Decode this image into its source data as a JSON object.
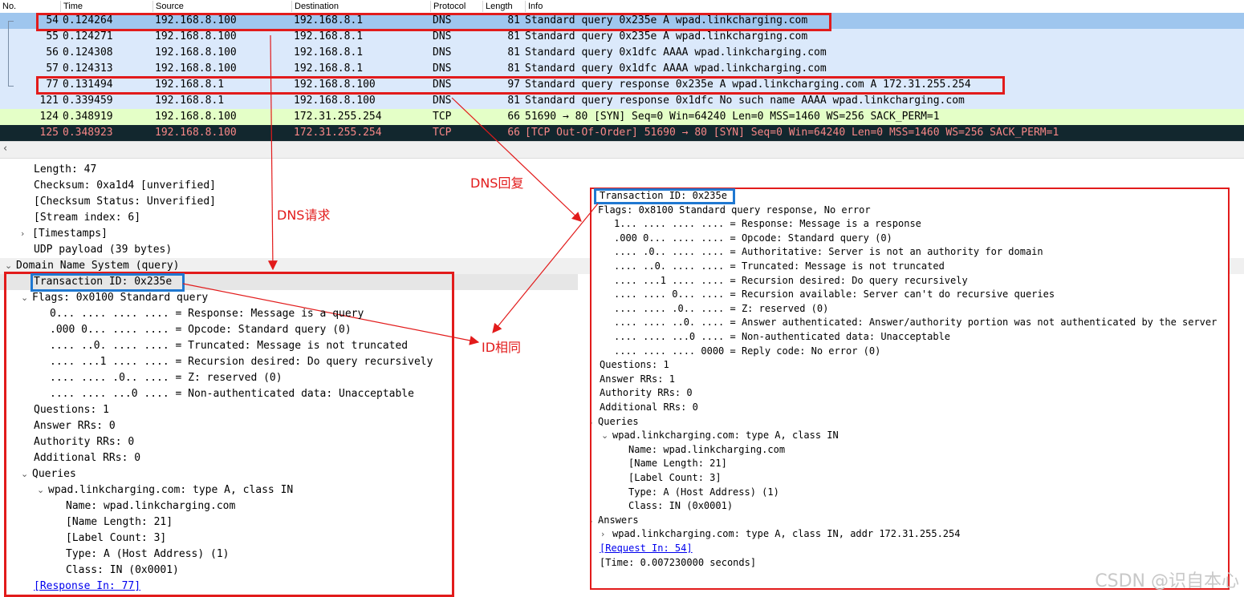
{
  "columns": {
    "no": "No.",
    "time": "Time",
    "source": "Source",
    "destination": "Destination",
    "protocol": "Protocol",
    "length": "Length",
    "info": "Info"
  },
  "packets": [
    {
      "no": "54",
      "time": "0.124264",
      "source": "192.168.8.100",
      "destination": "192.168.8.1",
      "protocol": "DNS",
      "length": "81",
      "info": "Standard query 0x235e A wpad.linkcharging.com",
      "bg": "#9fc6ee",
      "fg": "#000000"
    },
    {
      "no": "55",
      "time": "0.124271",
      "source": "192.168.8.100",
      "destination": "192.168.8.1",
      "protocol": "DNS",
      "length": "81",
      "info": "Standard query 0x235e A wpad.linkcharging.com",
      "bg": "#dbe9fb",
      "fg": "#000000"
    },
    {
      "no": "56",
      "time": "0.124308",
      "source": "192.168.8.100",
      "destination": "192.168.8.1",
      "protocol": "DNS",
      "length": "81",
      "info": "Standard query 0x1dfc AAAA wpad.linkcharging.com",
      "bg": "#dbe9fb",
      "fg": "#000000"
    },
    {
      "no": "57",
      "time": "0.124313",
      "source": "192.168.8.100",
      "destination": "192.168.8.1",
      "protocol": "DNS",
      "length": "81",
      "info": "Standard query 0x1dfc AAAA wpad.linkcharging.com",
      "bg": "#dbe9fb",
      "fg": "#000000"
    },
    {
      "no": "77",
      "time": "0.131494",
      "source": "192.168.8.1",
      "destination": "192.168.8.100",
      "protocol": "DNS",
      "length": "97",
      "info": "Standard query response 0x235e A wpad.linkcharging.com A 172.31.255.254",
      "bg": "#dbe9fb",
      "fg": "#000000"
    },
    {
      "no": "121",
      "time": "0.339459",
      "source": "192.168.8.1",
      "destination": "192.168.8.100",
      "protocol": "DNS",
      "length": "81",
      "info": "Standard query response 0x1dfc No such name AAAA wpad.linkcharging.com",
      "bg": "#dbe9fb",
      "fg": "#000000"
    },
    {
      "no": "124",
      "time": "0.348919",
      "source": "192.168.8.100",
      "destination": "172.31.255.254",
      "protocol": "TCP",
      "length": "66",
      "info": "51690 → 80 [SYN] Seq=0 Win=64240 Len=0 MSS=1460 WS=256 SACK_PERM=1",
      "bg": "#e4ffc7",
      "fg": "#000000"
    },
    {
      "no": "125",
      "time": "0.348923",
      "source": "192.168.8.100",
      "destination": "172.31.255.254",
      "protocol": "TCP",
      "length": "66",
      "info": "[TCP Out-Of-Order] 51690 → 80 [SYN] Seq=0 Win=64240 Len=0 MSS=1460 WS=256 SACK_PERM=1",
      "bg": "#12272e",
      "fg": "#f78787"
    }
  ],
  "request_detail": [
    {
      "text": "Length: 47",
      "indent": 2,
      "tog": ""
    },
    {
      "text": "Checksum: 0xa1d4 [unverified]",
      "indent": 2,
      "tog": ""
    },
    {
      "text": "[Checksum Status: Unverified]",
      "indent": 2,
      "tog": ""
    },
    {
      "text": "[Stream index: 6]",
      "indent": 2,
      "tog": ""
    },
    {
      "text": "[Timestamps]",
      "indent": 2,
      "tog": "›"
    },
    {
      "text": "UDP payload (39 bytes)",
      "indent": 2,
      "tog": ""
    },
    {
      "text": "Domain Name System (query)",
      "indent": 0,
      "tog": "⌄"
    },
    {
      "text": "Transaction ID: 0x235e",
      "indent": 2,
      "tog": ""
    },
    {
      "text": "Flags: 0x0100 Standard query",
      "indent": 2,
      "tog": "⌄"
    },
    {
      "text": "0... .... .... .... = Response: Message is a query",
      "indent": 4,
      "tog": ""
    },
    {
      "text": ".000 0... .... .... = Opcode: Standard query (0)",
      "indent": 4,
      "tog": ""
    },
    {
      "text": ".... ..0. .... .... = Truncated: Message is not truncated",
      "indent": 4,
      "tog": ""
    },
    {
      "text": ".... ...1 .... .... = Recursion desired: Do query recursively",
      "indent": 4,
      "tog": ""
    },
    {
      "text": ".... .... .0.. .... = Z: reserved (0)",
      "indent": 4,
      "tog": ""
    },
    {
      "text": ".... .... ...0 .... = Non-authenticated data: Unacceptable",
      "indent": 4,
      "tog": ""
    },
    {
      "text": "Questions: 1",
      "indent": 2,
      "tog": ""
    },
    {
      "text": "Answer RRs: 0",
      "indent": 2,
      "tog": ""
    },
    {
      "text": "Authority RRs: 0",
      "indent": 2,
      "tog": ""
    },
    {
      "text": "Additional RRs: 0",
      "indent": 2,
      "tog": ""
    },
    {
      "text": "Queries",
      "indent": 2,
      "tog": "⌄"
    },
    {
      "text": "wpad.linkcharging.com: type A, class IN",
      "indent": 4,
      "tog": "⌄"
    },
    {
      "text": "Name: wpad.linkcharging.com",
      "indent": 6,
      "tog": ""
    },
    {
      "text": "[Name Length: 21]",
      "indent": 6,
      "tog": ""
    },
    {
      "text": "[Label Count: 3]",
      "indent": 6,
      "tog": ""
    },
    {
      "text": "Type: A (Host Address) (1)",
      "indent": 6,
      "tog": ""
    },
    {
      "text": "Class: IN (0x0001)",
      "indent": 6,
      "tog": ""
    },
    {
      "text": "[Response In: 77]",
      "indent": 2,
      "tog": "",
      "link": true
    }
  ],
  "response_detail": [
    {
      "text": "Transaction ID: 0x235e",
      "indent": 0,
      "tog": ""
    },
    {
      "text": "Flags: 0x8100 Standard query response, No error",
      "indent": 0,
      "tog": "⌄"
    },
    {
      "text": "1... .... .... .... = Response: Message is a response",
      "indent": 2,
      "tog": ""
    },
    {
      "text": ".000 0... .... .... = Opcode: Standard query (0)",
      "indent": 2,
      "tog": ""
    },
    {
      "text": ".... .0.. .... .... = Authoritative: Server is not an authority for domain",
      "indent": 2,
      "tog": ""
    },
    {
      "text": ".... ..0. .... .... = Truncated: Message is not truncated",
      "indent": 2,
      "tog": ""
    },
    {
      "text": ".... ...1 .... .... = Recursion desired: Do query recursively",
      "indent": 2,
      "tog": ""
    },
    {
      "text": ".... .... 0... .... = Recursion available: Server can't do recursive queries",
      "indent": 2,
      "tog": ""
    },
    {
      "text": ".... .... .0.. .... = Z: reserved (0)",
      "indent": 2,
      "tog": ""
    },
    {
      "text": ".... .... ..0. .... = Answer authenticated: Answer/authority portion was not authenticated by the server",
      "indent": 2,
      "tog": ""
    },
    {
      "text": ".... .... ...0 .... = Non-authenticated data: Unacceptable",
      "indent": 2,
      "tog": ""
    },
    {
      "text": ".... .... .... 0000 = Reply code: No error (0)",
      "indent": 2,
      "tog": ""
    },
    {
      "text": "Questions: 1",
      "indent": 0,
      "tog": ""
    },
    {
      "text": "Answer RRs: 1",
      "indent": 0,
      "tog": ""
    },
    {
      "text": "Authority RRs: 0",
      "indent": 0,
      "tog": ""
    },
    {
      "text": "Additional RRs: 0",
      "indent": 0,
      "tog": ""
    },
    {
      "text": "Queries",
      "indent": 0,
      "tog": "⌄"
    },
    {
      "text": "wpad.linkcharging.com: type A, class IN",
      "indent": 2,
      "tog": "⌄"
    },
    {
      "text": "Name: wpad.linkcharging.com",
      "indent": 4,
      "tog": ""
    },
    {
      "text": "[Name Length: 21]",
      "indent": 4,
      "tog": ""
    },
    {
      "text": "[Label Count: 3]",
      "indent": 4,
      "tog": ""
    },
    {
      "text": "Type: A (Host Address) (1)",
      "indent": 4,
      "tog": ""
    },
    {
      "text": "Class: IN (0x0001)",
      "indent": 4,
      "tog": ""
    },
    {
      "text": "Answers",
      "indent": 0,
      "tog": "⌄"
    },
    {
      "text": "wpad.linkcharging.com: type A, class IN, addr 172.31.255.254",
      "indent": 2,
      "tog": "›"
    },
    {
      "text": "[Request In: 54]",
      "indent": 0,
      "tog": "",
      "link": true
    },
    {
      "text": "[Time: 0.007230000 seconds]",
      "indent": 0,
      "tog": ""
    }
  ],
  "annotations": {
    "dns_request": "DNS请求",
    "dns_reply": "DNS回复",
    "id_same": "ID相同"
  },
  "watermark": "CSDN @识自本心",
  "colors": {
    "annotation_red": "#e21b1b",
    "highlight_blue": "#1f78d1"
  }
}
